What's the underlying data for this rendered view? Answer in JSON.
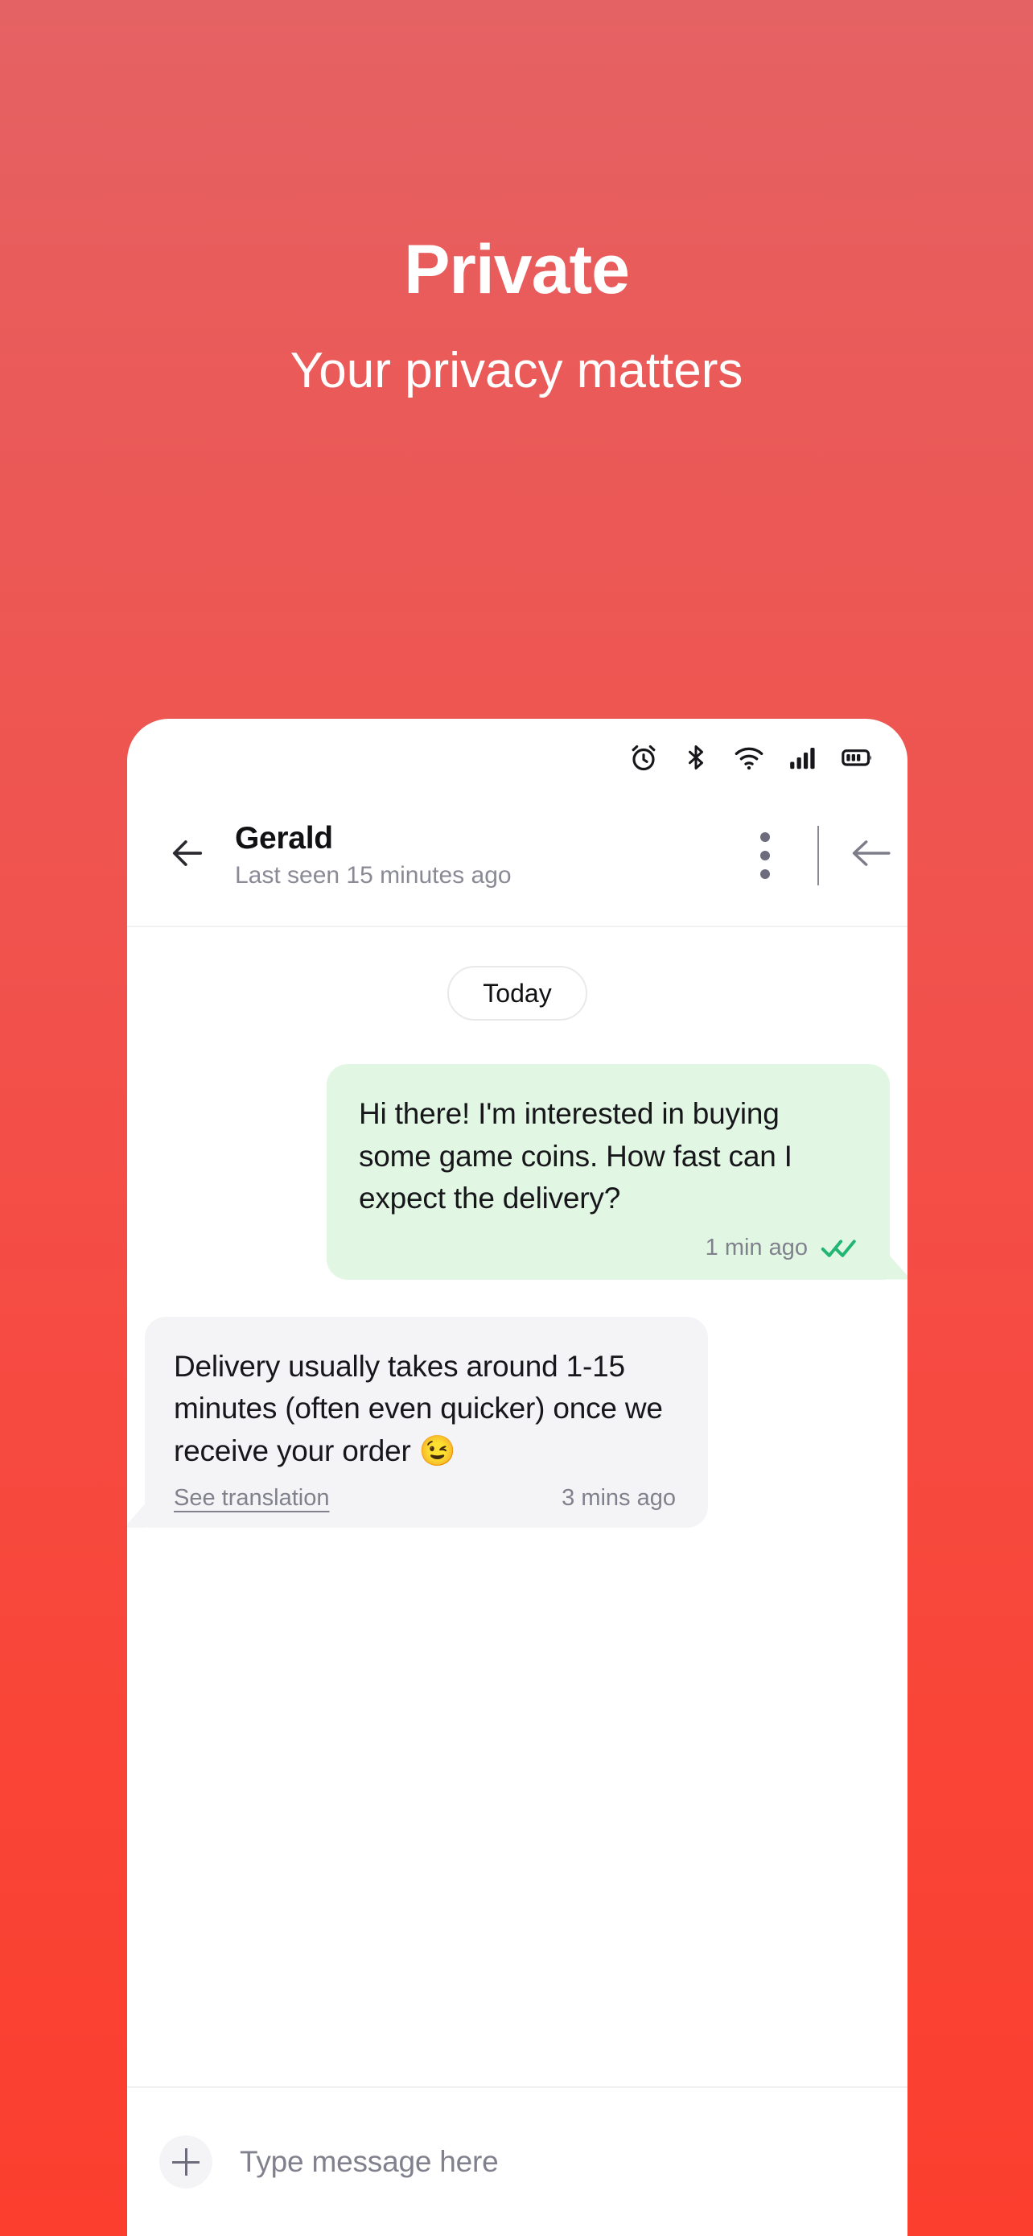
{
  "hero": {
    "title": "Private",
    "subtitle": "Your privacy matters"
  },
  "colors": {
    "background_top": "#E56264",
    "background_bottom": "#FB3E2E",
    "outgoing_bubble": "#E2F7E3",
    "incoming_bubble": "#F4F4F6",
    "tick_green": "#22B573",
    "muted_text": "#81818D",
    "icon_grey": "#6C6C7C"
  },
  "statusbar": {
    "icons": [
      "alarm-clock-icon",
      "bluetooth-icon",
      "wifi-icon",
      "cellular-signal-icon",
      "battery-icon"
    ]
  },
  "chat_header": {
    "back_icon": "arrow-left-icon",
    "peer_name": "Gerald",
    "peer_status": "Last seen 15 minutes ago",
    "menu_icon": "more-vertical-icon",
    "nav_back_icon": "arrow-left-icon"
  },
  "conversation": {
    "day_divider": "Today",
    "messages": [
      {
        "direction": "outgoing",
        "text": "Hi there! I'm interested in buying some game coins. How fast can I expect the delivery?",
        "time": "1 min ago",
        "status_icon": "double-check-icon",
        "read": true
      },
      {
        "direction": "incoming",
        "text": "Delivery usually takes around 1-15 minutes (often even quicker) once we receive your order 😉",
        "translation_label": "See translation",
        "time": "3 mins ago"
      }
    ]
  },
  "composer": {
    "attach_icon": "plus-icon",
    "placeholder": "Type message here",
    "value": ""
  }
}
